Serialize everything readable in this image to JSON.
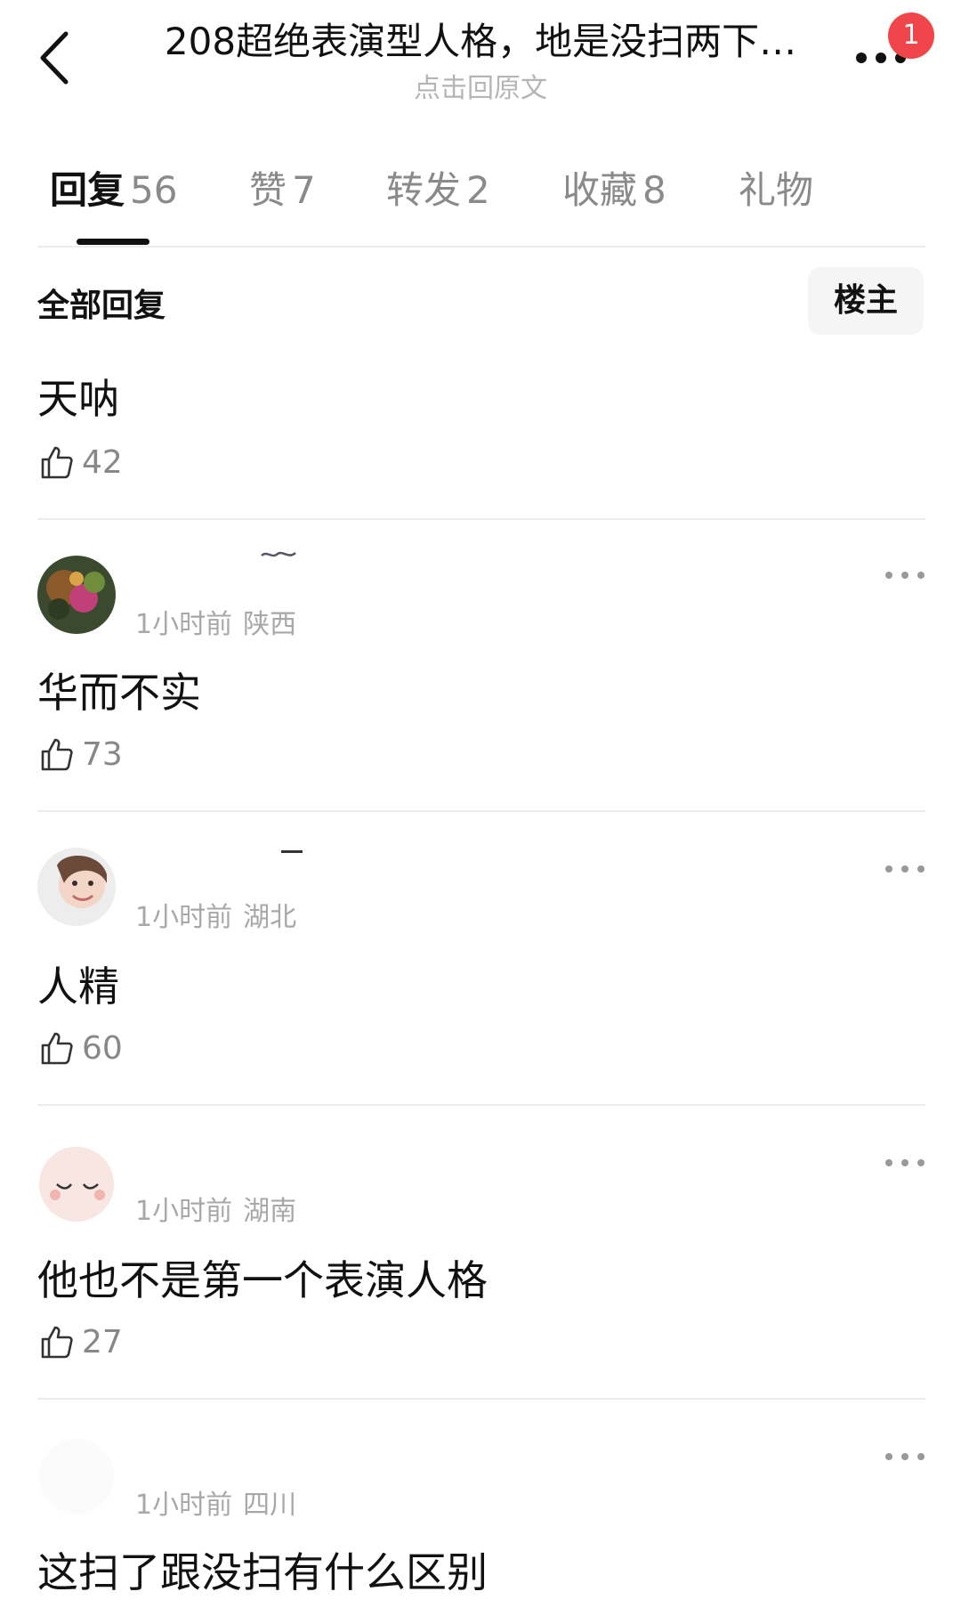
{
  "header": {
    "title": "208超绝表演型人格，地是没扫两下…",
    "subtitle": "点击回原文",
    "notification_count": "1",
    "back_icon": "chevron-left-icon",
    "more_icon": "more-horizontal-icon"
  },
  "tabs": [
    {
      "label": "回复",
      "count": "56",
      "active": true
    },
    {
      "label": "赞",
      "count": "7",
      "active": false
    },
    {
      "label": "转发",
      "count": "2",
      "active": false
    },
    {
      "label": "收藏",
      "count": "8",
      "active": false
    },
    {
      "label": "礼物",
      "count": "",
      "active": false
    }
  ],
  "section": {
    "title": "全部回复",
    "filter_label": "楼主"
  },
  "comments": [
    {
      "text": "天呐",
      "likes": "42"
    },
    {
      "time": "1小时前",
      "location": "陕西",
      "text": "华而不实",
      "likes": "73"
    },
    {
      "time": "1小时前",
      "location": "湖北",
      "text": "人精",
      "likes": "60"
    },
    {
      "time": "1小时前",
      "location": "湖南",
      "text": "他也不是第一个表演人格",
      "likes": "27"
    },
    {
      "time": "1小时前",
      "location": "四川",
      "text": "这扫了跟没扫有什么区别"
    }
  ],
  "colors": {
    "badge": "#f0454a",
    "text_primary": "#111111",
    "text_secondary": "#a8a8a8",
    "divider": "#ececec"
  }
}
